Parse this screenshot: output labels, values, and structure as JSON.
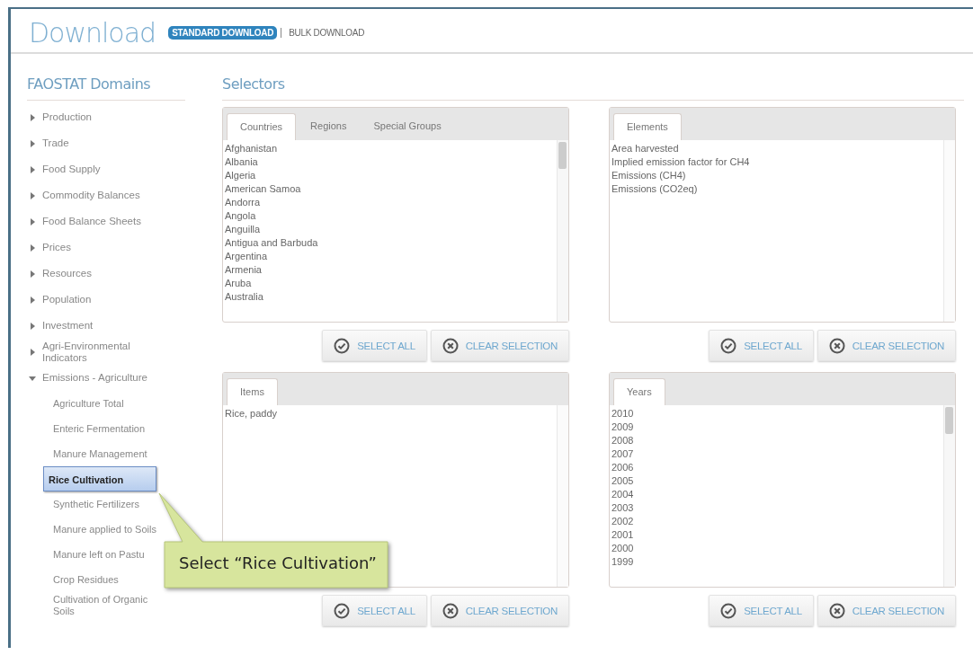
{
  "header": {
    "title": "Download",
    "tabs": [
      {
        "label": "STANDARD DOWNLOAD",
        "selected": true
      },
      {
        "label": "BULK DOWNLOAD",
        "selected": false
      }
    ]
  },
  "sidebar": {
    "title": "FAOSTAT Domains",
    "items": [
      {
        "label": "Production",
        "expanded": false
      },
      {
        "label": "Trade",
        "expanded": false
      },
      {
        "label": "Food Supply",
        "expanded": false
      },
      {
        "label": "Commodity Balances",
        "expanded": false
      },
      {
        "label": "Food Balance Sheets",
        "expanded": false
      },
      {
        "label": "Prices",
        "expanded": false
      },
      {
        "label": "Resources",
        "expanded": false
      },
      {
        "label": "Population",
        "expanded": false
      },
      {
        "label": "Investment",
        "expanded": false
      },
      {
        "label": "Agri-Environmental Indicators",
        "expanded": false
      },
      {
        "label": "Emissions - Agriculture",
        "expanded": true,
        "children": [
          {
            "label": "Agriculture Total",
            "selected": false
          },
          {
            "label": "Enteric Fermentation",
            "selected": false
          },
          {
            "label": "Manure Management",
            "selected": false
          },
          {
            "label": "Rice Cultivation",
            "selected": true
          },
          {
            "label": "Synthetic Fertilizers",
            "selected": false
          },
          {
            "label": "Manure applied to Soils",
            "selected": false
          },
          {
            "label": "Manure left on Pastu",
            "selected": false
          },
          {
            "label": "Crop Residues",
            "selected": false
          },
          {
            "label": "Cultivation of Organic Soils",
            "selected": false
          }
        ]
      }
    ]
  },
  "selectors": {
    "title": "Selectors",
    "panels": [
      {
        "tabs": [
          {
            "label": "Countries",
            "selected": true
          },
          {
            "label": "Regions",
            "selected": false
          },
          {
            "label": "Special Groups",
            "selected": false
          }
        ],
        "items": [
          "Afghanistan",
          "Albania",
          "Algeria",
          "American Samoa",
          "Andorra",
          "Angola",
          "Anguilla",
          "Antigua and Barbuda",
          "Argentina",
          "Armenia",
          "Aruba",
          "Australia"
        ],
        "scrollbar": true,
        "buttons": [
          "SELECT ALL",
          "CLEAR SELECTION"
        ]
      },
      {
        "tabs": [
          {
            "label": "Elements",
            "selected": true
          }
        ],
        "items": [
          "Area harvested",
          "Implied emission factor for CH4",
          "Emissions (CH4)",
          "Emissions (CO2eq)"
        ],
        "scrollbar": false,
        "buttons": [
          "SELECT ALL",
          "CLEAR SELECTION"
        ]
      },
      {
        "tabs": [
          {
            "label": "Items",
            "selected": true
          }
        ],
        "items": [
          "Rice, paddy"
        ],
        "scrollbar": false,
        "buttons": [
          "SELECT ALL",
          "CLEAR SELECTION"
        ]
      },
      {
        "tabs": [
          {
            "label": "Years",
            "selected": true
          }
        ],
        "items": [
          "2010",
          "2009",
          "2008",
          "2007",
          "2006",
          "2005",
          "2004",
          "2003",
          "2002",
          "2001",
          "2000",
          "1999"
        ],
        "scrollbar": true,
        "buttons": [
          "SELECT ALL",
          "CLEAR SELECTION"
        ]
      }
    ]
  },
  "callout": {
    "text": "Select “Rice Cultivation”"
  }
}
